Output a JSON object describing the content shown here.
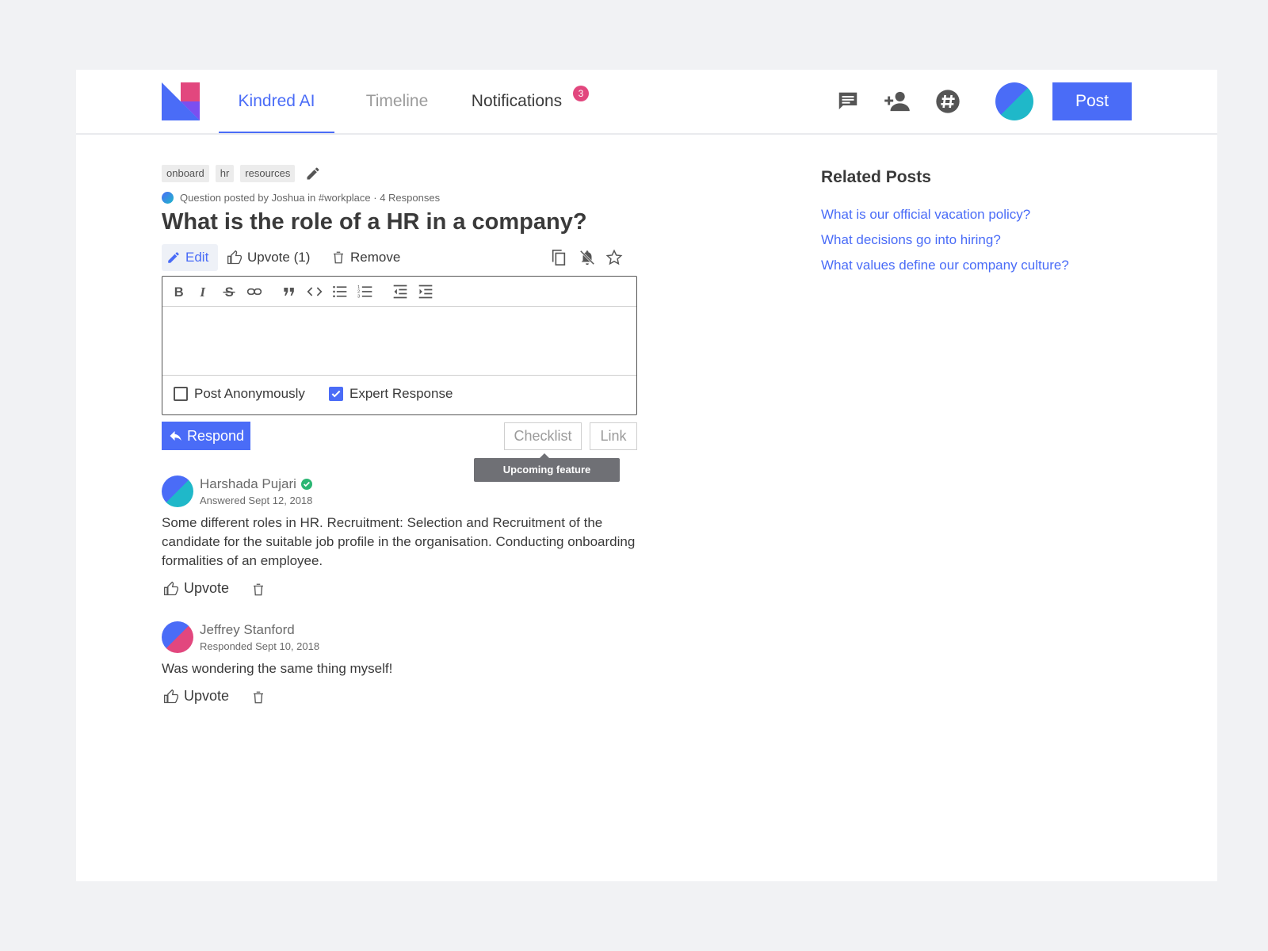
{
  "header": {
    "tabs": [
      {
        "label": "Kindred AI",
        "active": true
      },
      {
        "label": "Timeline",
        "active": false
      },
      {
        "label": "Notifications",
        "active": false
      }
    ],
    "notification_count": "3",
    "icons": [
      "chat-icon",
      "add-user-icon",
      "slack-icon"
    ],
    "post_label": "Post"
  },
  "question": {
    "tags": [
      "onboard",
      "hr",
      "resources"
    ],
    "meta": "Question posted by Joshua in #workplace · 4 Responses",
    "title": "What is the role of a HR in a company?",
    "actions": {
      "edit": "Edit",
      "upvote": "Upvote (1)",
      "remove": "Remove"
    }
  },
  "editor": {
    "toolbar": [
      "bold",
      "italic",
      "strikethrough",
      "link",
      "quote",
      "code",
      "bullet-list",
      "numbered-list",
      "outdent",
      "indent"
    ],
    "options": {
      "anonymous_label": "Post Anonymously",
      "anonymous_checked": false,
      "expert_label": "Expert Response",
      "expert_checked": true
    },
    "respond_label": "Respond",
    "checklist_label": "Checklist",
    "link_label": "Link",
    "tooltip": "Upcoming feature"
  },
  "responses": [
    {
      "name": "Harshada Pujari",
      "verified": true,
      "date": "Answered Sept 12, 2018",
      "body": "Some different roles in HR. Recruitment: Selection and Recruitment of the candidate for the suitable job profile in the organisation. Conducting onboarding formalities of an employee.",
      "upvote_label": "Upvote"
    },
    {
      "name": "Jeffrey Stanford",
      "verified": false,
      "date": "Responded Sept 10, 2018",
      "body": "Was wondering the same thing myself!",
      "upvote_label": "Upvote"
    }
  ],
  "related": {
    "title": "Related Posts",
    "links": [
      "What is our official vacation policy?",
      "What decisions go into hiring?",
      "What values define our company culture?"
    ]
  },
  "colors": {
    "accent": "#4a6cf7",
    "badge": "#e2477e",
    "teal": "#1fb8c9",
    "verified": "#2bb673"
  }
}
